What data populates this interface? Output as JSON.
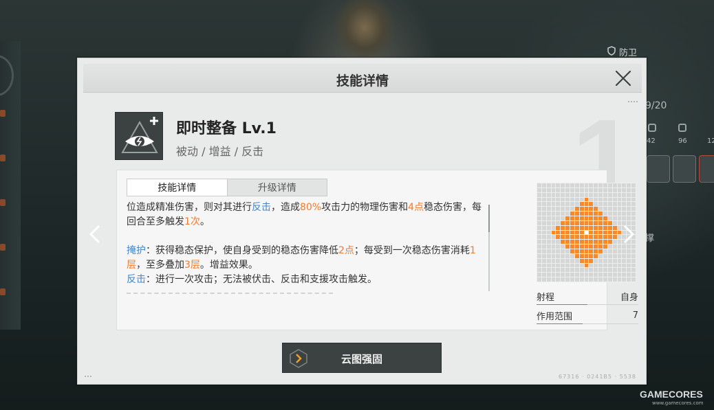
{
  "background": {
    "defense_label": "防卫",
    "count_text": "9/20",
    "stats": [
      "42",
      "96",
      "12"
    ],
    "tag_text": "撑"
  },
  "modal": {
    "title": "技能详情",
    "big_level_number": "1",
    "skill": {
      "name": "即时整备 Lv.1",
      "tags": "被动 / 增益 / 反击",
      "icon": "eye-triangle-plus-icon"
    },
    "tabs": [
      {
        "label": "技能详情",
        "active": true
      },
      {
        "label": "升级详情",
        "active": false
      }
    ],
    "description": {
      "p1": {
        "t1": "位造成精准伤害，则对其进行",
        "k1": "反击",
        "t2": "，造成",
        "v1": "80%",
        "t3": "攻击力的物理伤害和",
        "v2": "4点",
        "t4": "稳态伤害，每回合至多触发",
        "v3": "1次",
        "t5": "。"
      },
      "p2": {
        "k1": "掩护",
        "t1": "：获得稳态保护，使自身受到的稳态伤害降低",
        "v1": "2点",
        "t2": "；每受到一次稳态伤害消耗",
        "v2": "1层",
        "t3": "，至多叠加",
        "v3": "3层",
        "t4": "。增益效果。"
      },
      "p3": {
        "k1": "反击",
        "t1": "：进行一次攻击；无法被伏击、反击和支援攻击触发。"
      }
    },
    "range": {
      "grid_size": 21,
      "radius": 7,
      "rows": [
        {
          "label": "射程",
          "value": "自身",
          "bar_fill": 0.5
        },
        {
          "label": "作用范围",
          "value": "7",
          "bar_fill": 0.45
        }
      ]
    },
    "reinforce_button": {
      "label": "云图强固"
    },
    "footer_code": "67316 · 0241B5 · 5538"
  },
  "colors": {
    "accent_orange": "#f07b2e",
    "keyword_blue": "#3f86c8",
    "range_cell": "#f58a2a"
  },
  "watermark": {
    "brand": "GAMECORES",
    "site": "www.gamecores.com"
  }
}
